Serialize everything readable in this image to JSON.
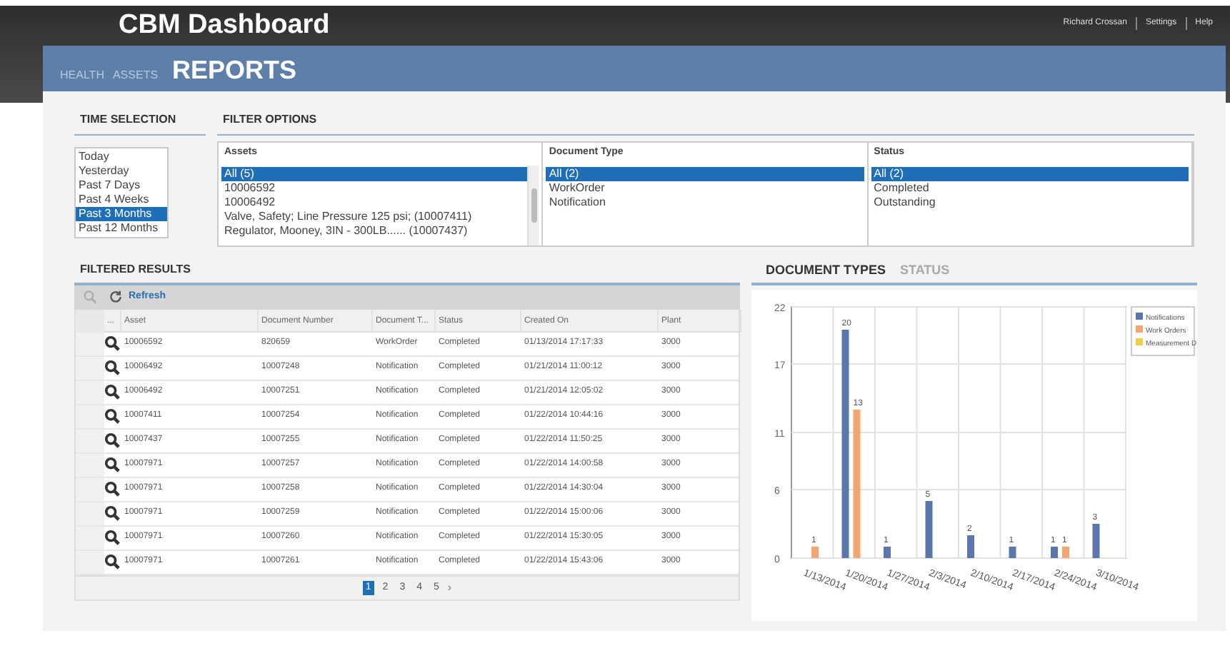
{
  "header": {
    "title": "CBM Dashboard",
    "links": [
      "Richard Crossan",
      "Settings",
      "Help"
    ]
  },
  "nav_tabs": [
    {
      "label": "HEALTH",
      "selected": false
    },
    {
      "label": "ASSETS",
      "selected": false
    },
    {
      "label": "REPORTS",
      "selected": true
    }
  ],
  "time_selection": {
    "title": "TIME SELECTION",
    "items": [
      {
        "label": "Today",
        "selected": false
      },
      {
        "label": "Yesterday",
        "selected": false
      },
      {
        "label": "Past 7 Days",
        "selected": false
      },
      {
        "label": "Past 4 Weeks",
        "selected": false
      },
      {
        "label": "Past 3 Months",
        "selected": true
      },
      {
        "label": "Past 12 Months",
        "selected": false
      }
    ]
  },
  "filter_options": {
    "title": "FILTER OPTIONS",
    "lists": [
      {
        "heading": "Assets",
        "scrollable": true,
        "items": [
          {
            "label": "All (5)",
            "selected": true
          },
          {
            "label": "10006592",
            "selected": false
          },
          {
            "label": "10006492",
            "selected": false
          },
          {
            "label": "Valve, Safety; Line Pressure 125 psi; (10007411)",
            "selected": false
          },
          {
            "label": "Regulator, Mooney, 3IN - 300LB...... (10007437)",
            "selected": false
          }
        ]
      },
      {
        "heading": "Document Type",
        "scrollable": false,
        "items": [
          {
            "label": "All (2)",
            "selected": true
          },
          {
            "label": "WorkOrder",
            "selected": false
          },
          {
            "label": "Notification",
            "selected": false
          }
        ]
      },
      {
        "heading": "Status",
        "scrollable": false,
        "items": [
          {
            "label": "All (2)",
            "selected": true
          },
          {
            "label": "Completed",
            "selected": false
          },
          {
            "label": "Outstanding",
            "selected": false
          }
        ]
      }
    ]
  },
  "filtered_results": {
    "title": "FILTERED RESULTS",
    "toolbar": {
      "view_disabled": true,
      "refresh": "Refresh"
    },
    "columns": [
      "...",
      "Asset",
      "Document Number",
      "Document T...",
      "Status",
      "Created On",
      "Plant"
    ],
    "rows": [
      [
        "",
        "10006592",
        "820659",
        "WorkOrder",
        "Completed",
        "01/13/2014 17:17:33",
        "3000"
      ],
      [
        "",
        "10006492",
        "10007248",
        "Notification",
        "Completed",
        "01/21/2014 11:00:12",
        "3000"
      ],
      [
        "",
        "10006492",
        "10007251",
        "Notification",
        "Completed",
        "01/21/2014 12:05:02",
        "3000"
      ],
      [
        "",
        "10007411",
        "10007254",
        "Notification",
        "Completed",
        "01/22/2014 10:44:16",
        "3000"
      ],
      [
        "",
        "10007437",
        "10007255",
        "Notification",
        "Completed",
        "01/22/2014 11:50:25",
        "3000"
      ],
      [
        "",
        "10007971",
        "10007257",
        "Notification",
        "Completed",
        "01/22/2014 14:00:58",
        "3000"
      ],
      [
        "",
        "10007971",
        "10007258",
        "Notification",
        "Completed",
        "01/22/2014 14:30:04",
        "3000"
      ],
      [
        "",
        "10007971",
        "10007259",
        "Notification",
        "Completed",
        "01/22/2014 15:00:06",
        "3000"
      ],
      [
        "",
        "10007971",
        "10007260",
        "Notification",
        "Completed",
        "01/22/2014 15:30:05",
        "3000"
      ],
      [
        "",
        "10007971",
        "10007261",
        "Notification",
        "Completed",
        "01/22/2014 15:43:06",
        "3000"
      ]
    ],
    "pages": [
      {
        "label": "1",
        "selected": true
      },
      {
        "label": "2",
        "selected": false
      },
      {
        "label": "3",
        "selected": false
      },
      {
        "label": "4",
        "selected": false
      },
      {
        "label": "5",
        "selected": false
      }
    ],
    "next": "›"
  },
  "chart_tabs": [
    {
      "label": "DOCUMENT TYPES",
      "selected": true
    },
    {
      "label": "STATUS",
      "selected": false
    }
  ],
  "chart_data": {
    "type": "bar",
    "categories": [
      "1/13/2014",
      "1/20/2014",
      "1/27/2014",
      "2/3/2014",
      "2/10/2014",
      "2/17/2014",
      "2/24/2014",
      "3/10/2014"
    ],
    "series": [
      {
        "name": "Notifications",
        "color": "#5b76ad",
        "values": [
          null,
          20,
          1,
          5,
          2,
          1,
          1,
          3
        ]
      },
      {
        "name": "Work Orders",
        "color": "#f5a474",
        "values": [
          1,
          13,
          null,
          null,
          null,
          null,
          1,
          null
        ]
      },
      {
        "name": "Measurement D",
        "color": "#ecd04a",
        "values": [
          null,
          null,
          null,
          null,
          null,
          null,
          null,
          null
        ]
      }
    ],
    "ylim": [
      0,
      22
    ],
    "yticks": [
      0,
      6,
      11,
      17,
      22
    ],
    "value_labels": [
      [
        null,
        "20",
        "1",
        "5",
        "2",
        "1",
        "1",
        "3"
      ],
      [
        "1",
        "13",
        null,
        null,
        null,
        null,
        "1",
        null
      ],
      [
        null,
        null,
        null,
        null,
        null,
        null,
        null,
        null
      ]
    ],
    "grid": true,
    "legend": true
  }
}
